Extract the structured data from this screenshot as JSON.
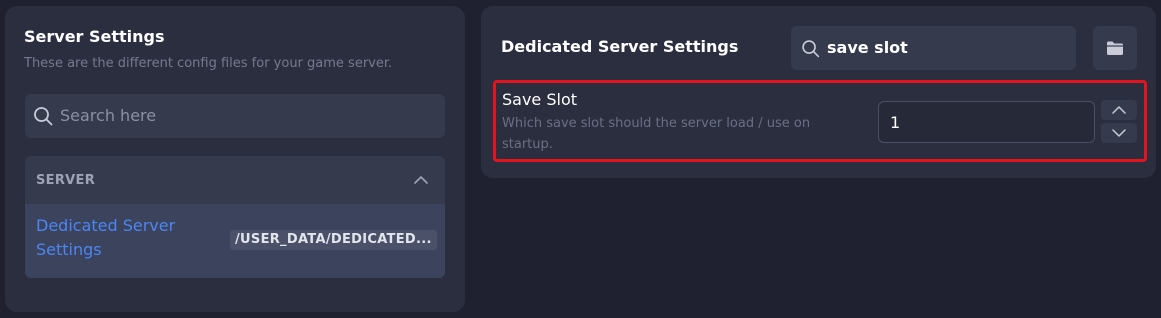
{
  "sidebar": {
    "title": "Server Settings",
    "subtitle": "These are the different config files for your game server.",
    "search_placeholder": "Search here",
    "group": {
      "label": "SERVER",
      "items": [
        {
          "name": "Dedicated Server Settings",
          "path": "/USER_DATA/DEDICATED..."
        }
      ]
    }
  },
  "main": {
    "title": "Dedicated Server Settings",
    "filter_value": "save slot",
    "setting": {
      "title": "Save Slot",
      "description": "Which save slot should the server load / use on startup.",
      "value": "1"
    }
  },
  "colors": {
    "accent_blue": "#4b86f5",
    "highlight_red": "#e3141d",
    "panel_bg": "#2b2e3f",
    "page_bg": "#1f2130"
  },
  "icons": {
    "search": "search-icon",
    "chevron_up": "chevron-up-icon",
    "folder": "folder-icon",
    "step_up": "chevron-up-icon",
    "step_down": "chevron-down-icon"
  }
}
